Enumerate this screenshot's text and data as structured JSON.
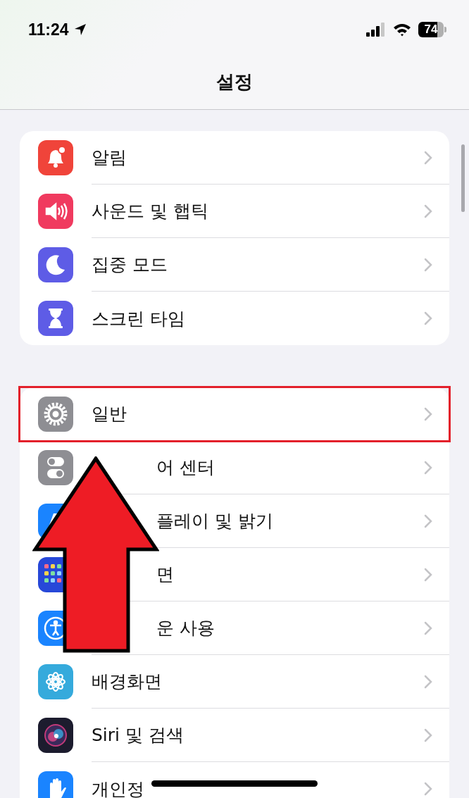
{
  "status_bar": {
    "time": "11:24",
    "battery": "74"
  },
  "title": "설정",
  "groups": [
    {
      "items": [
        {
          "label": "알림",
          "highlighted": false,
          "kind": "plain"
        },
        {
          "label": "사운드 및 햅틱",
          "highlighted": false,
          "kind": "plain"
        },
        {
          "label": "집중 모드",
          "highlighted": false,
          "kind": "plain"
        },
        {
          "label": "스크린 타임",
          "highlighted": false,
          "kind": "plain"
        }
      ]
    },
    {
      "items": [
        {
          "label": "일반",
          "highlighted": true,
          "kind": "plain"
        },
        {
          "label": "어 센터",
          "highlighted": false,
          "kind": "covered"
        },
        {
          "label": "플레이 및 밝기",
          "highlighted": false,
          "kind": "covered"
        },
        {
          "label": "면",
          "highlighted": false,
          "kind": "covered"
        },
        {
          "label": "운 사용",
          "highlighted": false,
          "kind": "covered"
        },
        {
          "label": "배경화면",
          "highlighted": false,
          "kind": "plain"
        },
        {
          "label": "Siri 및 검색",
          "highlighted": false,
          "kind": "plain"
        },
        {
          "label": "개인정",
          "highlighted": false,
          "kind": "plain"
        }
      ]
    }
  ]
}
